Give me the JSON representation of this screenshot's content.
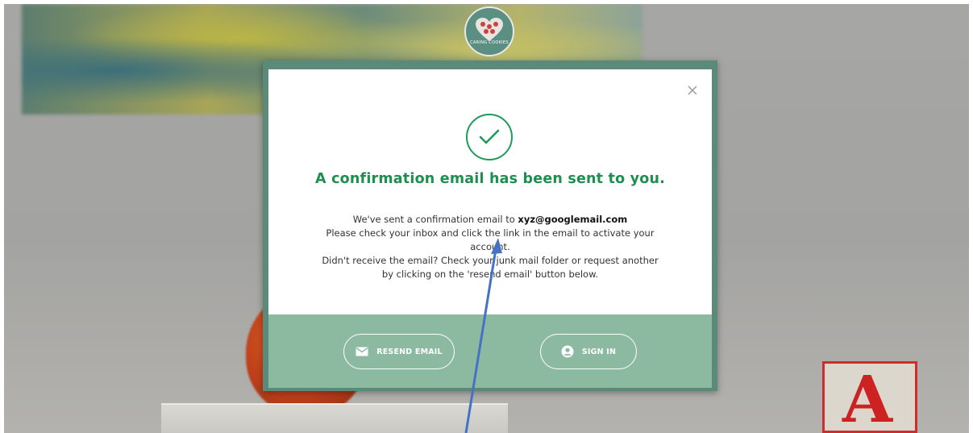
{
  "logo": {
    "text": "CARING COOKIES"
  },
  "modal": {
    "title": "A confirmation email has been sent to you.",
    "body_prefix": "We've sent a confirmation email to ",
    "email": "xyz@googlemail.com",
    "body_line2": "Please check your inbox and click the link in the email to activate your",
    "body_line3": "account.",
    "body_line4": "Didn't receive the email? Check your junk mail folder or request another",
    "body_line5": "by clicking on the 'resend email' button below.",
    "resend_label": "RESEND EMAIL",
    "signin_label": "SIGN IN"
  },
  "background": {
    "block_letter": "A"
  },
  "colors": {
    "accent_green": "#1e8f4f",
    "footer_green": "#8bbaa0",
    "frame_green": "#5b8a7a",
    "arrow_blue": "#4472c4"
  },
  "icons": {
    "close": "close-icon",
    "check": "check-circle-icon",
    "mail": "mail-icon",
    "user": "user-circle-icon"
  }
}
